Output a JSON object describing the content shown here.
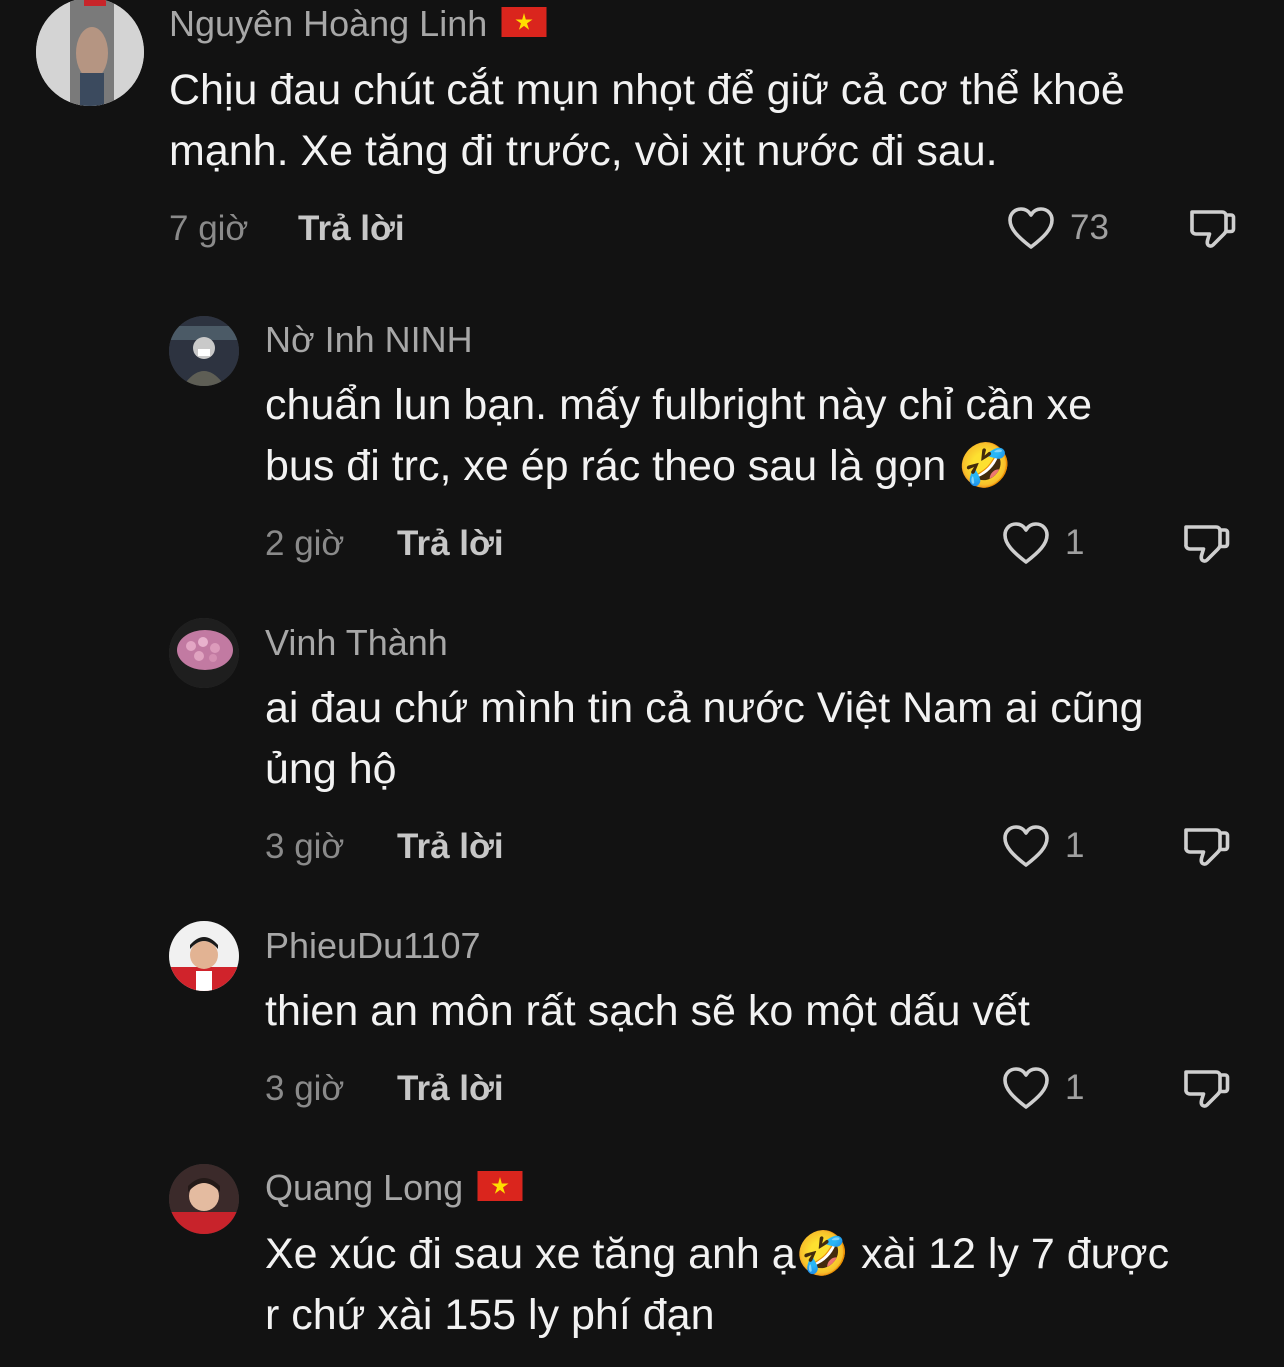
{
  "comments": [
    {
      "username": "Nguyên Hoàng Linh",
      "flag": "vietnam-flag",
      "lines": [
        "Chịu đau chút cắt mụn nhọt để giữ cả cơ thể khoẻ",
        "mạnh. Xe tăng đi trước, vòi xịt nước đi sau."
      ],
      "time": "7 giờ",
      "reply_label": "Trả lời",
      "likes": "73"
    },
    {
      "username": "Nờ Inh NINH",
      "lines": [
        "chuẩn lun bạn. mấy fulbright này chỉ cần xe",
        "bus đi trc, xe ép rác theo sau là gọn 🤣"
      ],
      "time": "2 giờ",
      "reply_label": "Trả lời",
      "likes": "1"
    },
    {
      "username": "Vinh Thành",
      "lines": [
        "ai đau chứ mình tin cả nước Việt Nam ai cũng",
        "ủng hộ"
      ],
      "time": "3 giờ",
      "reply_label": "Trả lời",
      "likes": "1"
    },
    {
      "username": "PhieuDu1107",
      "lines": [
        "thien an môn rất sạch sẽ ko một dấu vết"
      ],
      "time": "3 giờ",
      "reply_label": "Trả lời",
      "likes": "1"
    },
    {
      "username": "Quang Long",
      "flag": "vietnam-flag",
      "lines": [
        "Xe xúc đi sau xe tăng anh ạ🤣 xài 12 ly 7 được",
        "r chứ xài 155 ly phí đạn"
      ]
    }
  ],
  "colors": {
    "background": "#121212",
    "username": "#a7a7a7",
    "text": "#f2f2f2",
    "flag_red": "#da251d",
    "flag_star": "#ffde00"
  },
  "icons": {
    "like": "heart-outline-icon",
    "dislike": "thumbs-down-outline-icon"
  }
}
